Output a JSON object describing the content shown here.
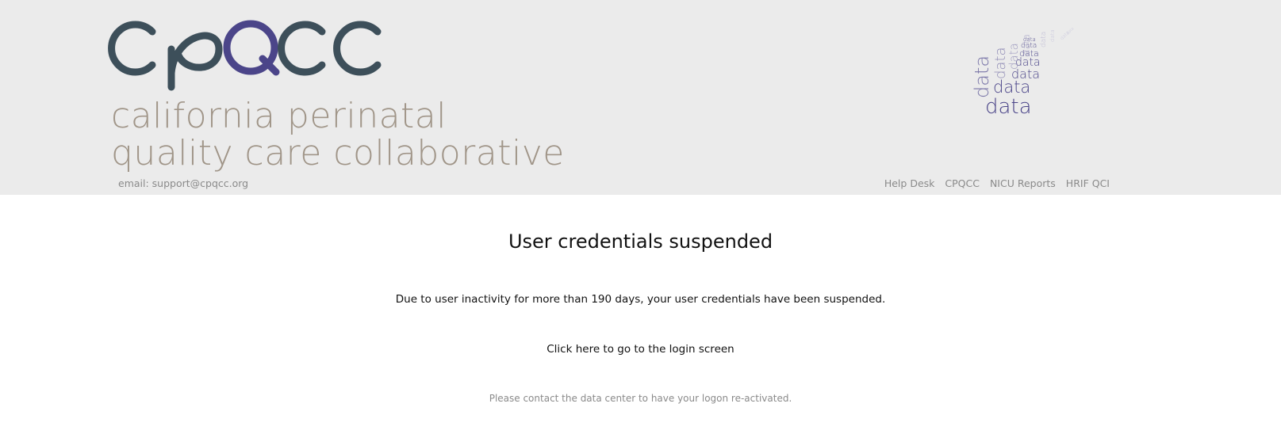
{
  "header": {
    "logo_acronym": "cpqcc",
    "logo_line1": "california perinatal",
    "logo_line2": "quality care collaborative",
    "email": "email: support@cpqcc.org",
    "nav": [
      "Help Desk",
      "CPQCC",
      "NICU Reports",
      "HRIF QCI"
    ],
    "cloud_word": "data",
    "colors": {
      "dark": "#3d4f5a",
      "purple": "#4b4589",
      "tan": "#a09588",
      "background": "#ebebeb"
    }
  },
  "main": {
    "title": "User credentials suspended",
    "message": "Due to user inactivity for more than 190 days, your user credentials have been suspended.",
    "login_link": "Click here to go to the login screen",
    "contact": "Please contact the data center to have your logon re-activated."
  }
}
